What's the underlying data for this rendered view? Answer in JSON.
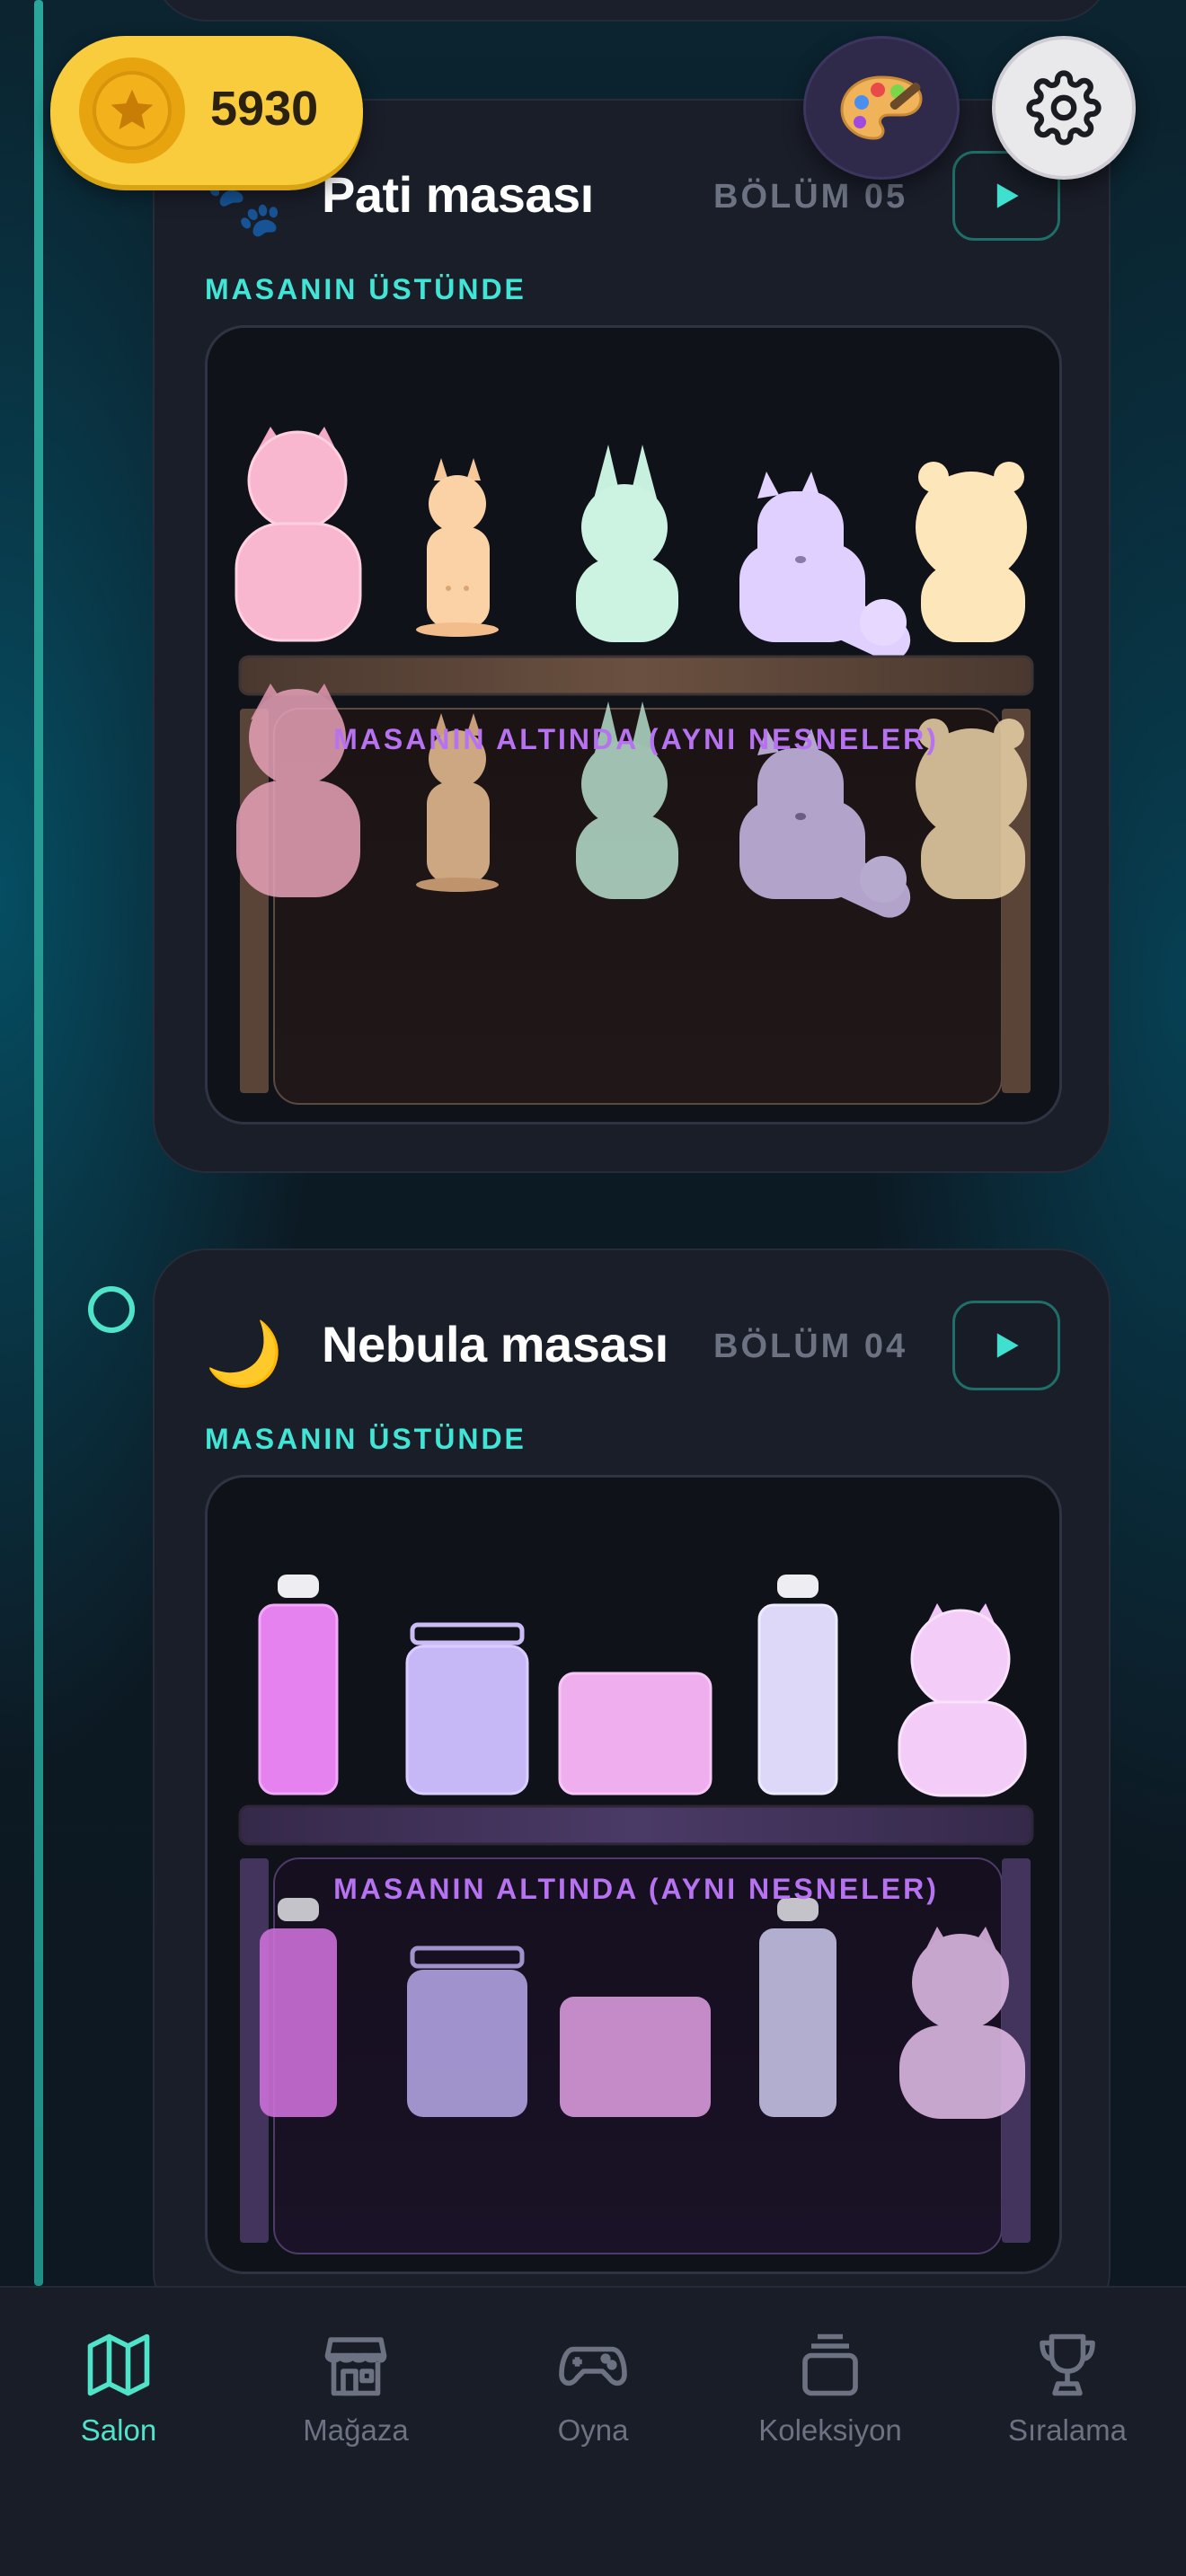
{
  "hud": {
    "coins": "5930",
    "coin_icon": "star-coin-icon",
    "palette_icon": "palette-icon",
    "settings_icon": "gear-icon"
  },
  "tables": [
    {
      "emoji": "🐾",
      "title": "Pati masası",
      "chapter": "BÖLÜM 05",
      "top_label": "MASANIN ÜSTÜNDE",
      "under_label": "MASANIN ALTINDA (AYNI NESNELER)",
      "items": [
        "pink-cat",
        "orange-dog",
        "mint-bunny",
        "lavender-cat",
        "cream-bear"
      ],
      "shelf_color": "#6a5040"
    },
    {
      "emoji": "🌙",
      "title": "Nebula masası",
      "chapter": "BÖLÜM 04",
      "top_label": "MASANIN ÜSTÜNDE",
      "under_label": "MASANIN ALTINDA (AYNI NESNELER)",
      "items": [
        "magenta-bottle",
        "lavender-jar",
        "pink-box",
        "white-bottle",
        "pink-cat"
      ],
      "shelf_color": "#4a3a66"
    }
  ],
  "tabs": [
    {
      "label": "Salon",
      "icon": "map-icon",
      "active": true
    },
    {
      "label": "Mağaza",
      "icon": "store-icon",
      "active": false
    },
    {
      "label": "Oyna",
      "icon": "gamepad-icon",
      "active": false
    },
    {
      "label": "Koleksiyon",
      "icon": "collection-icon",
      "active": false
    },
    {
      "label": "Sıralama",
      "icon": "trophy-icon",
      "active": false
    }
  ],
  "colors": {
    "accent": "#4fe3c9",
    "section_label": "#41e5d6",
    "under_label": "#b772f2",
    "coin_bg": "#f8cc3c"
  }
}
